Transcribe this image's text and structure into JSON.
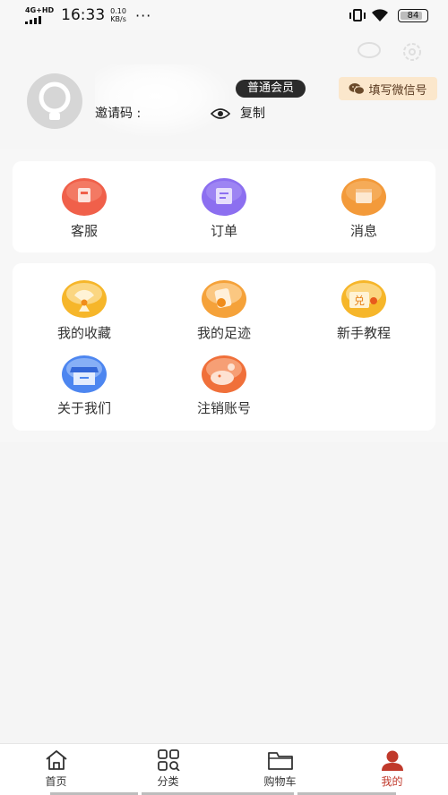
{
  "status_bar": {
    "network": "4G+HD",
    "time": "16:33",
    "speed_value": "0.10",
    "speed_unit": "KB/s",
    "more": "···",
    "battery": "84"
  },
  "profile": {
    "member_badge": "普通会员",
    "invite_label": "邀请码 :",
    "copy_label": "复制",
    "wechat_button": "填写微信号"
  },
  "quick_menu": [
    {
      "label": "客服",
      "icon": "customer-service-icon",
      "color": "#f0604a"
    },
    {
      "label": "订单",
      "icon": "order-icon",
      "color": "#8c6ff0"
    },
    {
      "label": "消息",
      "icon": "message-icon",
      "color": "#f39a3a"
    }
  ],
  "more_menu": [
    {
      "label": "我的收藏",
      "icon": "favorites-icon"
    },
    {
      "label": "我的足迹",
      "icon": "footprint-icon"
    },
    {
      "label": "新手教程",
      "icon": "tutorial-icon"
    },
    {
      "label": "关于我们",
      "icon": "about-us-icon"
    },
    {
      "label": "注销账号",
      "icon": "cancel-account-icon"
    }
  ],
  "tab_bar": {
    "tabs": [
      {
        "label": "首页",
        "icon": "home-icon"
      },
      {
        "label": "分类",
        "icon": "category-icon"
      },
      {
        "label": "购物车",
        "icon": "cart-icon"
      },
      {
        "label": "我的",
        "icon": "profile-icon",
        "active": true
      }
    ],
    "active_color": "#c0392b"
  }
}
